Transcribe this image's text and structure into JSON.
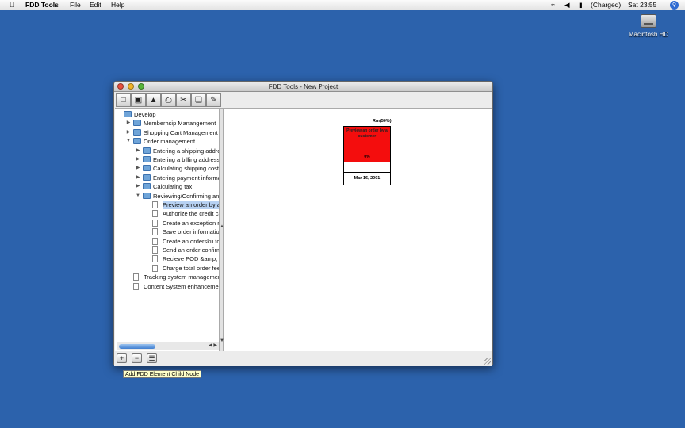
{
  "menubar": {
    "apple_icon": "apple-icon",
    "app_name": "FDD Tools",
    "menus": [
      "File",
      "Edit",
      "Help"
    ],
    "battery": "(Charged)",
    "clock": "Sat 23:55"
  },
  "desktop": {
    "hd_label": "Macintosh HD"
  },
  "window": {
    "title": "FDD Tools - New Project",
    "toolbar": [
      "new-document-icon",
      "open-book-icon",
      "save-icon",
      "print-icon",
      "cut-icon",
      "copy-icon",
      "paste-icon"
    ]
  },
  "tree": [
    {
      "label": "Develop",
      "level": 0,
      "type": "folder",
      "expanded": null
    },
    {
      "label": "Memberhsip Manangement",
      "level": 1,
      "type": "folder",
      "expanded": false
    },
    {
      "label": "Shopping Cart Management",
      "level": 1,
      "type": "folder",
      "expanded": false
    },
    {
      "label": "Order management",
      "level": 1,
      "type": "folder",
      "expanded": true
    },
    {
      "label": "Entering a shipping addres",
      "level": 2,
      "type": "folder",
      "expanded": false
    },
    {
      "label": "Entering a billing address",
      "level": 2,
      "type": "folder",
      "expanded": false
    },
    {
      "label": "Calculating shipping cost",
      "level": 2,
      "type": "folder",
      "expanded": false
    },
    {
      "label": "Entering payment informati",
      "level": 2,
      "type": "folder",
      "expanded": false
    },
    {
      "label": "Calculating tax",
      "level": 2,
      "type": "folder",
      "expanded": false
    },
    {
      "label": "Reviewing/Confirming an o",
      "level": 2,
      "type": "folder",
      "expanded": true
    },
    {
      "label": "Preview an order by a c",
      "level": 3,
      "type": "file",
      "selected": true
    },
    {
      "label": "Authorize the credit car",
      "level": 3,
      "type": "file"
    },
    {
      "label": "Create an exception rep",
      "level": 3,
      "type": "file"
    },
    {
      "label": "Save order information",
      "level": 3,
      "type": "file"
    },
    {
      "label": "Create an ordersku to c",
      "level": 3,
      "type": "file"
    },
    {
      "label": "Send an order confirma",
      "level": 3,
      "type": "file"
    },
    {
      "label": "Recieve POD &amp; E-c",
      "level": 3,
      "type": "file"
    },
    {
      "label": "Charge total order fees",
      "level": 3,
      "type": "file"
    },
    {
      "label": "Tracking system management",
      "level": 1,
      "type": "file"
    },
    {
      "label": "Content System enhancement",
      "level": 1,
      "type": "file"
    }
  ],
  "feature_card": {
    "owner_pct": "Rm(50%)",
    "name": "Preview an order by a customer",
    "percent": "0%",
    "date": "Mar 16, 2001",
    "color": "#f40d0d"
  },
  "bottom_buttons": {
    "add": "+",
    "remove": "−",
    "list": "☰"
  },
  "tooltip": "Add FDD Element Child Node"
}
